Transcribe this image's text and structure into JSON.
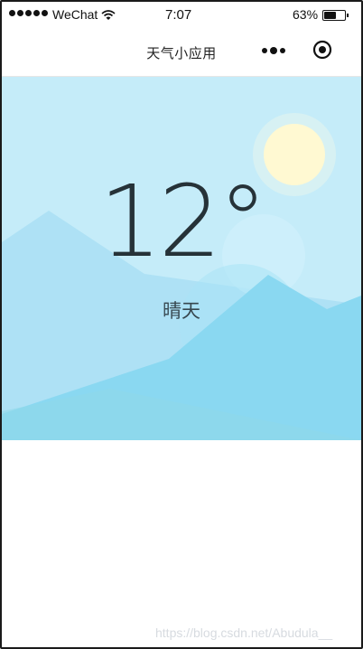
{
  "status_bar": {
    "carrier": "WeChat",
    "time": "7:07",
    "battery": "63%",
    "battery_level": 0.63,
    "signal_icon": "signal-dots-icon",
    "wifi_icon": "wifi-icon",
    "battery_icon": "battery-icon"
  },
  "nav": {
    "title": "天气小应用",
    "more_icon": "more-dots-icon",
    "close_icon": "target-close-icon"
  },
  "weather": {
    "temperature": "12°",
    "condition": "晴天",
    "background_color": "#c5ecf9",
    "sun_color": "#fff9d2"
  },
  "watermark": "https://blog.csdn.net/Abudula__"
}
